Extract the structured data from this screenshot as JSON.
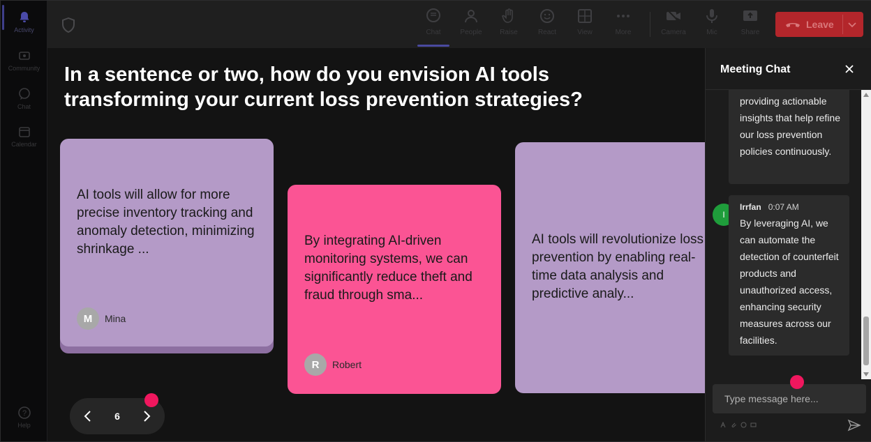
{
  "rail": {
    "items": [
      {
        "label": "Activity"
      },
      {
        "label": "Community"
      },
      {
        "label": "Chat"
      },
      {
        "label": "Calendar"
      },
      {
        "label": "Help"
      }
    ]
  },
  "toolbar": {
    "buttons": [
      {
        "label": "Chat"
      },
      {
        "label": "People"
      },
      {
        "label": "Raise"
      },
      {
        "label": "React"
      },
      {
        "label": "View"
      },
      {
        "label": "More"
      },
      {
        "label": "Camera"
      },
      {
        "label": "Mic"
      },
      {
        "label": "Share"
      }
    ],
    "leave_label": "Leave"
  },
  "stage": {
    "question": "In a sentence or two, how do you envision AI tools transforming your current loss prevention strategies?",
    "cards": [
      {
        "text": "AI tools will allow for more precise inventory tracking and anomaly detection, minimizing shrinkage ...",
        "author": "Mina",
        "initial": "M"
      },
      {
        "text": "By integrating AI-driven monitoring systems, we can significantly reduce theft and fraud through sma...",
        "author": "Robert",
        "initial": "R"
      },
      {
        "text": "AI tools will revolutionize loss prevention by enabling real-time data analysis and predictive analy...",
        "author": "",
        "initial": ""
      }
    ],
    "pager": {
      "page": "6"
    }
  },
  "chat": {
    "title": "Meeting Chat",
    "messages": [
      {
        "text": "providing actionable insights that help refine our loss prevention policies continuously."
      },
      {
        "sender": "Irrfan",
        "initial": "I",
        "time": "0:07 AM",
        "text": "By leveraging AI, we can automate the detection of counterfeit products and unauthorized access, enhancing security measures across our facilities."
      }
    ],
    "input_placeholder": "Type message here..."
  },
  "colors": {
    "card_purple": "#b49ac7",
    "card_pink": "#fb5494",
    "leave_red": "#b3262b",
    "marker_pink": "#f0175e",
    "avatar_green": "#1f9d3b"
  }
}
